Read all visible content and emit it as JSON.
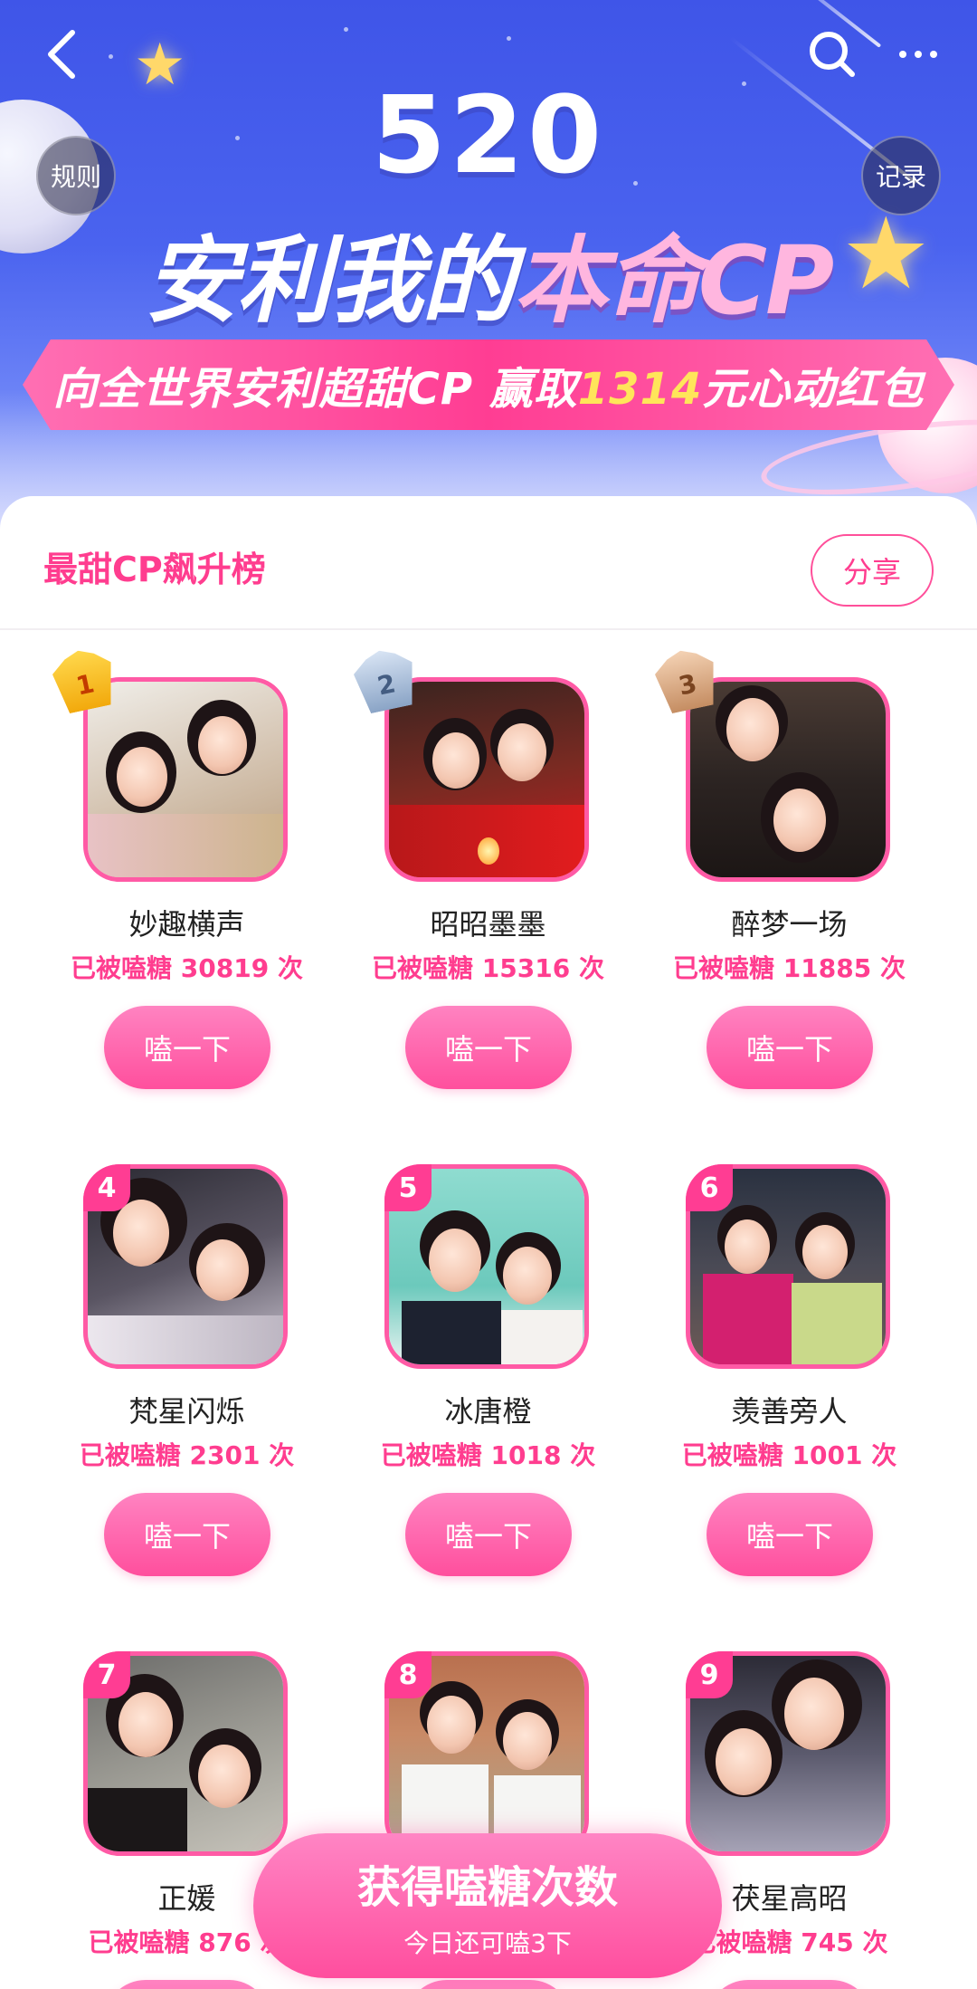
{
  "nav": {
    "back": "back",
    "search": "search",
    "more": "more"
  },
  "banner": {
    "number": "520",
    "title_white": "安利我的",
    "title_pink": "本命CP",
    "ribbon_pre": "向全世界安利超甜CP 赢取",
    "ribbon_amount": "1314",
    "ribbon_post": "元心动红包",
    "rules_label": "规则",
    "records_label": "记录"
  },
  "board": {
    "title": "最甜CP飙升榜",
    "share_label": "分享",
    "button_label": "嗑一下",
    "items": [
      {
        "rank": "1",
        "name": "妙趣横声",
        "count": "已被嗑糖 30819 次"
      },
      {
        "rank": "2",
        "name": "昭昭墨墨",
        "count": "已被嗑糖 15316 次"
      },
      {
        "rank": "3",
        "name": "醉梦一场",
        "count": "已被嗑糖 11885 次"
      },
      {
        "rank": "4",
        "name": "梵星闪烁",
        "count": "已被嗑糖 2301 次"
      },
      {
        "rank": "5",
        "name": "冰唐橙",
        "count": "已被嗑糖 1018 次"
      },
      {
        "rank": "6",
        "name": "羡善旁人",
        "count": "已被嗑糖 1001 次"
      },
      {
        "rank": "7",
        "name": "正媛",
        "count": "已被嗑糖 876 次"
      },
      {
        "rank": "8",
        "name": "",
        "count": ""
      },
      {
        "rank": "9",
        "name": "茯星高昭",
        "count": "已被嗑糖 745 次"
      }
    ]
  },
  "cta": {
    "title": "获得嗑糖次数",
    "subtitle": "今日还可嗑3下"
  },
  "colors": {
    "accent": "#ff3d8f",
    "banner": "#4a63ef",
    "ribbon_amount": "#ffe55a"
  }
}
